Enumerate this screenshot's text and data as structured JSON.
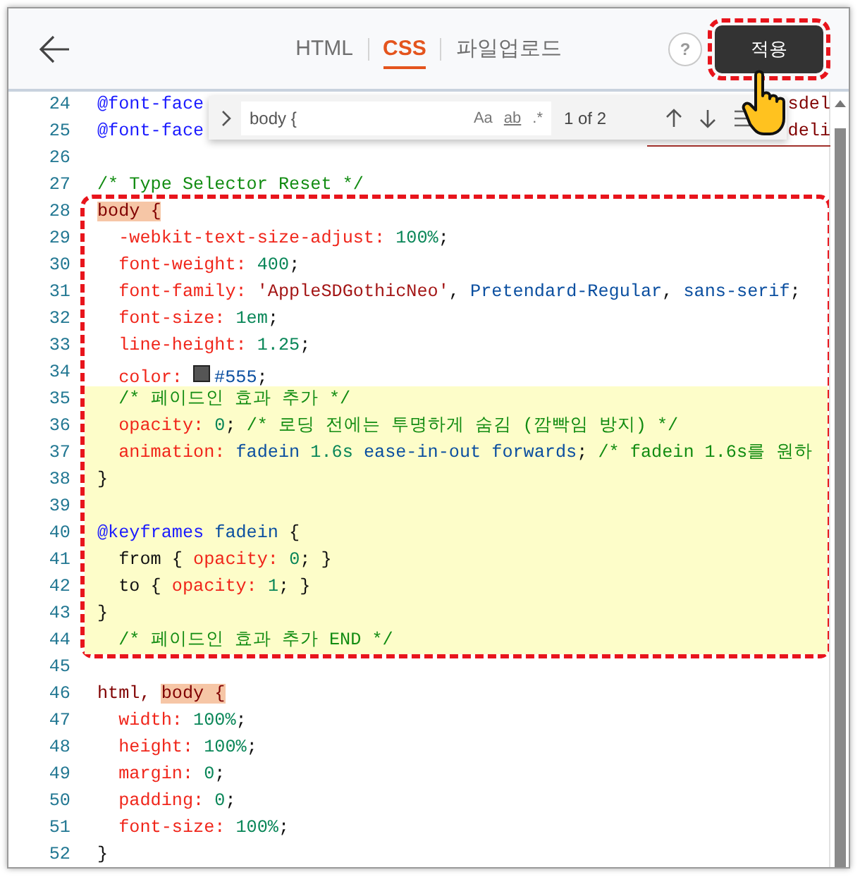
{
  "tabs": [
    {
      "label": "HTML",
      "selected": false
    },
    {
      "label": "CSS",
      "selected": true
    },
    {
      "label": "파일업로드",
      "selected": false
    }
  ],
  "help_button": "?",
  "apply_button": {
    "label": "적용",
    "annotated": true
  },
  "find": {
    "value": "body {",
    "options": [
      "Aa",
      "ab",
      ".*"
    ],
    "match_count": "1 of 2"
  },
  "code_lines": [
    {
      "number": "24",
      "tokens": [
        {
          "kind": "at",
          "text": "@font-face"
        }
      ],
      "tail": "sdel",
      "highlighted": false,
      "annotated": false
    },
    {
      "number": "25",
      "tokens": [
        {
          "kind": "at",
          "text": "@font-face"
        }
      ],
      "tail": "deli",
      "highlighted": false,
      "annotated": false
    },
    {
      "number": "26",
      "highlighted": false,
      "annotated": false
    },
    {
      "number": "27",
      "tokens": [
        {
          "kind": "comment",
          "text": "/* Type Selector Reset */"
        }
      ],
      "highlighted": false,
      "annotated": false
    },
    {
      "number": "28",
      "tokens": [
        {
          "kind": "selector",
          "text": "body {",
          "match": true
        }
      ],
      "highlighted": false,
      "annotated": true
    },
    {
      "number": "29",
      "tokens": [
        {
          "kind": "prop",
          "text": "  -webkit-text-size-adjust: "
        },
        {
          "kind": "num",
          "text": "100%"
        },
        {
          "kind": "punct",
          "text": ";"
        }
      ],
      "highlighted": false,
      "annotated": true
    },
    {
      "number": "30",
      "tokens": [
        {
          "kind": "prop",
          "text": "  font-weight: "
        },
        {
          "kind": "num",
          "text": "400"
        },
        {
          "kind": "punct",
          "text": ";"
        }
      ],
      "highlighted": false,
      "annotated": true
    },
    {
      "number": "31",
      "tokens": [
        {
          "kind": "prop",
          "text": "  font-family: "
        },
        {
          "kind": "string",
          "text": "'AppleSDGothicNeo'"
        },
        {
          "kind": "punct",
          "text": ", "
        },
        {
          "kind": "value",
          "text": "Pretendard-Regular"
        },
        {
          "kind": "punct",
          "text": ", "
        },
        {
          "kind": "value",
          "text": "sans-serif"
        },
        {
          "kind": "punct",
          "text": ";"
        }
      ],
      "highlighted": false,
      "annotated": true
    },
    {
      "number": "32",
      "tokens": [
        {
          "kind": "prop",
          "text": "  font-size: "
        },
        {
          "kind": "num",
          "text": "1em"
        },
        {
          "kind": "punct",
          "text": ";"
        }
      ],
      "highlighted": false,
      "annotated": true
    },
    {
      "number": "33",
      "tokens": [
        {
          "kind": "prop",
          "text": "  line-height: "
        },
        {
          "kind": "num",
          "text": "1.25"
        },
        {
          "kind": "punct",
          "text": ";"
        }
      ],
      "highlighted": false,
      "annotated": true
    },
    {
      "number": "34",
      "tokens": [
        {
          "kind": "prop",
          "text": "  color: "
        },
        {
          "kind": "swatch",
          "color": "#555555"
        },
        {
          "kind": "value",
          "text": "#555"
        },
        {
          "kind": "punct",
          "text": ";"
        }
      ],
      "highlighted": false,
      "annotated": true
    },
    {
      "number": "35",
      "tokens": [
        {
          "kind": "comment",
          "text": "  /* 페이드인 효과 추가 */"
        }
      ],
      "highlighted": true,
      "annotated": true
    },
    {
      "number": "36",
      "tokens": [
        {
          "kind": "prop",
          "text": "  opacity: "
        },
        {
          "kind": "num",
          "text": "0"
        },
        {
          "kind": "punct",
          "text": "; "
        },
        {
          "kind": "comment",
          "text": "/* 로딩 전에는 투명하게 숨김 (깜빡임 방지) */"
        }
      ],
      "highlighted": true,
      "annotated": true
    },
    {
      "number": "37",
      "tokens": [
        {
          "kind": "prop",
          "text": "  animation: "
        },
        {
          "kind": "value",
          "text": "fadein "
        },
        {
          "kind": "num",
          "text": "1.6s"
        },
        {
          "kind": "value",
          "text": " ease-in-out forwards"
        },
        {
          "kind": "punct",
          "text": "; "
        },
        {
          "kind": "comment",
          "text": "/* fadein 1.6s를 원하"
        }
      ],
      "highlighted": true,
      "annotated": true
    },
    {
      "number": "38",
      "tokens": [
        {
          "kind": "punct",
          "text": "}"
        }
      ],
      "highlighted": true,
      "annotated": true
    },
    {
      "number": "39",
      "highlighted": true,
      "annotated": true
    },
    {
      "number": "40",
      "tokens": [
        {
          "kind": "at",
          "text": "@keyframes"
        },
        {
          "kind": "value",
          "text": " fadein "
        },
        {
          "kind": "punct",
          "text": "{"
        }
      ],
      "highlighted": true,
      "annotated": true
    },
    {
      "number": "41",
      "tokens": [
        {
          "kind": "punct",
          "text": "  from { "
        },
        {
          "kind": "prop",
          "text": "opacity: "
        },
        {
          "kind": "num",
          "text": "0"
        },
        {
          "kind": "punct",
          "text": "; }"
        }
      ],
      "highlighted": true,
      "annotated": true
    },
    {
      "number": "42",
      "tokens": [
        {
          "kind": "punct",
          "text": "  to { "
        },
        {
          "kind": "prop",
          "text": "opacity: "
        },
        {
          "kind": "num",
          "text": "1"
        },
        {
          "kind": "punct",
          "text": "; }"
        }
      ],
      "highlighted": true,
      "annotated": true
    },
    {
      "number": "43",
      "tokens": [
        {
          "kind": "punct",
          "text": "}"
        }
      ],
      "highlighted": true,
      "annotated": true
    },
    {
      "number": "44",
      "tokens": [
        {
          "kind": "comment",
          "text": "  /* 페이드인 효과 추가 END */"
        }
      ],
      "highlighted": true,
      "annotated": true
    },
    {
      "number": "45",
      "highlighted": false,
      "annotated": false
    },
    {
      "number": "46",
      "tokens": [
        {
          "kind": "selector",
          "text": "html, "
        },
        {
          "kind": "selector",
          "text": "body {",
          "match": true
        }
      ],
      "highlighted": false,
      "annotated": false
    },
    {
      "number": "47",
      "tokens": [
        {
          "kind": "prop",
          "text": "  width: "
        },
        {
          "kind": "num",
          "text": "100%"
        },
        {
          "kind": "punct",
          "text": ";"
        }
      ],
      "highlighted": false,
      "annotated": false
    },
    {
      "number": "48",
      "tokens": [
        {
          "kind": "prop",
          "text": "  height: "
        },
        {
          "kind": "num",
          "text": "100%"
        },
        {
          "kind": "punct",
          "text": ";"
        }
      ],
      "highlighted": false,
      "annotated": false
    },
    {
      "number": "49",
      "tokens": [
        {
          "kind": "prop",
          "text": "  margin: "
        },
        {
          "kind": "num",
          "text": "0"
        },
        {
          "kind": "punct",
          "text": ";"
        }
      ],
      "highlighted": false,
      "annotated": false
    },
    {
      "number": "50",
      "tokens": [
        {
          "kind": "prop",
          "text": "  padding: "
        },
        {
          "kind": "num",
          "text": "0"
        },
        {
          "kind": "punct",
          "text": ";"
        }
      ],
      "highlighted": false,
      "annotated": false
    },
    {
      "number": "51",
      "tokens": [
        {
          "kind": "prop",
          "text": "  font-size: "
        },
        {
          "kind": "num",
          "text": "100%"
        },
        {
          "kind": "punct",
          "text": ";"
        }
      ],
      "highlighted": false,
      "annotated": false
    },
    {
      "number": "52",
      "tokens": [
        {
          "kind": "punct",
          "text": "}"
        }
      ],
      "highlighted": false,
      "annotated": false
    }
  ]
}
